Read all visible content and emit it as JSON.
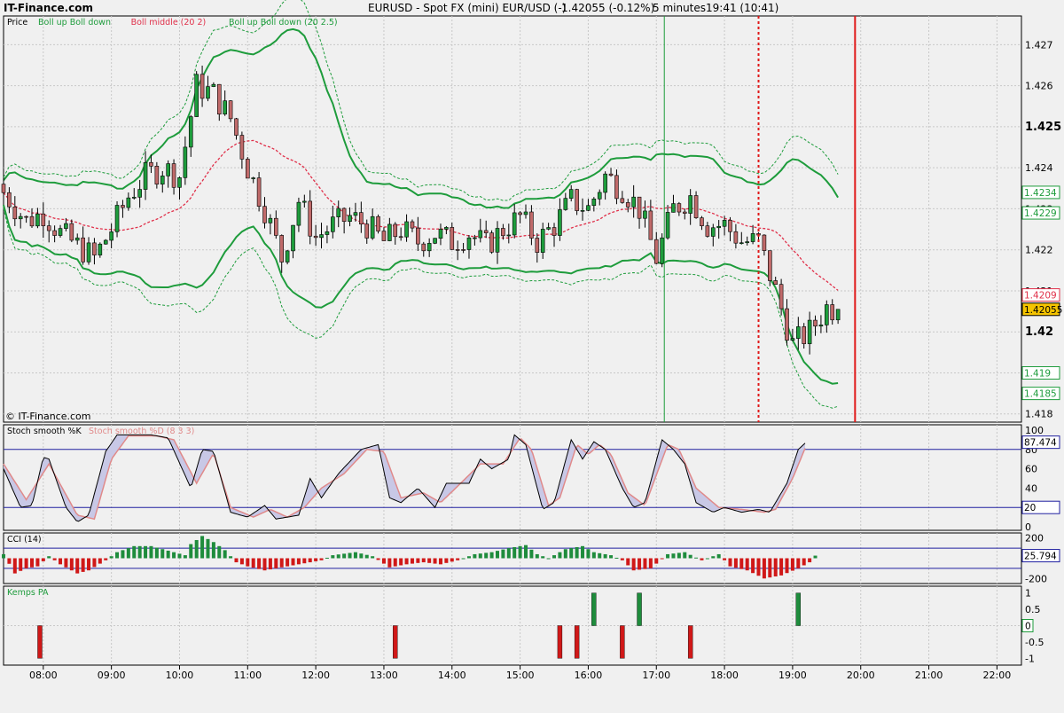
{
  "header": {
    "site": "IT-Finance.com",
    "title": "EURUSD - Spot FX (mini) EUR/USD (-)",
    "price": "1.42055 (-0.12%)",
    "interval": "5 minutes",
    "time": "19:41 (10:41)"
  },
  "watermark": "© IT-Finance.com",
  "colors": {
    "background": "#f0f0f0",
    "grid": "#c8c8c8",
    "candle_up": "#1e9c3c",
    "candle_down": "#c06a6a",
    "bollinger": "#1e9c3c",
    "boll_middle": "#e0304a",
    "stoch_k": "#000000",
    "stoch_d": "#e08a8a",
    "cci_up": "#1e8c3c",
    "cci_down": "#d01818",
    "now_line": "#e01818"
  },
  "chart_data": [
    {
      "type": "candlestick",
      "panel": "price",
      "legend": [
        "Price",
        "Boll up Boll down",
        "Boll middle (20 2)",
        "Boll up Boll down (20 2.5)"
      ],
      "x_ticks": [
        "08:00",
        "09:00",
        "10:00",
        "11:00",
        "12:00",
        "13:00",
        "14:00",
        "15:00",
        "16:00",
        "17:00",
        "18:00",
        "19:00",
        "20:00",
        "21:00",
        "22:00"
      ],
      "y_ticks": [
        "1.427",
        "1.426",
        "1.425",
        "1.424",
        "1.423",
        "1.422",
        "1.421",
        "1.42",
        "1.419",
        "1.418"
      ],
      "ylim": [
        1.4178,
        1.4277
      ],
      "x_range": [
        "07:25",
        "22:20"
      ],
      "markers": [
        {
          "label": "1.4234",
          "value": 1.4234,
          "color": "#1e9c3c"
        },
        {
          "label": "1.4229",
          "value": 1.4229,
          "color": "#1e9c3c"
        },
        {
          "label": "1.4209",
          "value": 1.4209,
          "color": "#e0304a"
        },
        {
          "label": "1.42055",
          "value": 1.42055,
          "color": "#000000",
          "bg": "#f5c400"
        },
        {
          "label": "1.419",
          "value": 1.419,
          "color": "#1e9c3c"
        },
        {
          "label": "1.4185",
          "value": 1.4185,
          "color": "#1e9c3c"
        }
      ],
      "vlines": [
        {
          "time": "17:07",
          "style": "solid",
          "color": "#1e9c3c"
        },
        {
          "time": "18:30",
          "style": "dotted",
          "color": "#e01818"
        },
        {
          "time": "19:55",
          "style": "solid",
          "color": "#e01818"
        }
      ],
      "ohlc_keyframes": [
        [
          "07:25",
          1.4234
        ],
        [
          "07:45",
          1.4227
        ],
        [
          "08:00",
          1.4229
        ],
        [
          "08:15",
          1.4224
        ],
        [
          "08:30",
          1.4221
        ],
        [
          "08:45",
          1.4218
        ],
        [
          "09:00",
          1.4225
        ],
        [
          "09:15",
          1.4233
        ],
        [
          "09:30",
          1.4238
        ],
        [
          "09:45",
          1.424
        ],
        [
          "10:00",
          1.4238
        ],
        [
          "10:15",
          1.426
        ],
        [
          "10:30",
          1.4258
        ],
        [
          "10:45",
          1.4252
        ],
        [
          "11:00",
          1.424
        ],
        [
          "11:15",
          1.423
        ],
        [
          "11:30",
          1.4218
        ],
        [
          "11:45",
          1.4232
        ],
        [
          "12:00",
          1.4223
        ],
        [
          "12:15",
          1.4226
        ],
        [
          "12:30",
          1.4228
        ],
        [
          "12:45",
          1.4226
        ],
        [
          "13:00",
          1.4222
        ],
        [
          "13:15",
          1.4225
        ],
        [
          "13:30",
          1.4222
        ],
        [
          "13:45",
          1.4224
        ],
        [
          "14:00",
          1.4222
        ],
        [
          "14:15",
          1.4224
        ],
        [
          "14:30",
          1.4221
        ],
        [
          "14:45",
          1.4225
        ],
        [
          "15:00",
          1.4228
        ],
        [
          "15:15",
          1.4222
        ],
        [
          "15:30",
          1.4226
        ],
        [
          "15:45",
          1.4232
        ],
        [
          "16:00",
          1.423
        ],
        [
          "16:15",
          1.4238
        ],
        [
          "16:30",
          1.4235
        ],
        [
          "16:45",
          1.423
        ],
        [
          "17:00",
          1.4218
        ],
        [
          "17:15",
          1.423
        ],
        [
          "17:30",
          1.4233
        ],
        [
          "17:45",
          1.4226
        ],
        [
          "18:00",
          1.4226
        ],
        [
          "18:15",
          1.4222
        ],
        [
          "18:30",
          1.4222
        ],
        [
          "18:45",
          1.421
        ],
        [
          "19:00",
          1.4197
        ],
        [
          "19:15",
          1.42
        ],
        [
          "19:30",
          1.4206
        ],
        [
          "19:41",
          1.42055
        ]
      ]
    },
    {
      "type": "line",
      "panel": "stochastic",
      "legend": [
        "Stoch smooth %K",
        "Stoch smooth %D (8 3 3)"
      ],
      "y_ticks": [
        "100",
        "80",
        "60",
        "40",
        "20",
        "0"
      ],
      "ylim": [
        0,
        100
      ],
      "levels": [
        20,
        80
      ],
      "markers": [
        {
          "label": "87.474",
          "value": 87.474
        },
        {
          "label": "20",
          "value": 20
        }
      ],
      "k_keyframes": [
        [
          "07:25",
          60
        ],
        [
          "07:40",
          20
        ],
        [
          "07:50",
          22
        ],
        [
          "08:00",
          72
        ],
        [
          "08:05",
          70
        ],
        [
          "08:20",
          20
        ],
        [
          "08:30",
          5
        ],
        [
          "08:40",
          12
        ],
        [
          "08:55",
          78
        ],
        [
          "09:05",
          95
        ],
        [
          "09:35",
          95
        ],
        [
          "09:50",
          92
        ],
        [
          "10:10",
          40
        ],
        [
          "10:20",
          80
        ],
        [
          "10:30",
          78
        ],
        [
          "10:45",
          15
        ],
        [
          "11:00",
          10
        ],
        [
          "11:15",
          22
        ],
        [
          "11:25",
          8
        ],
        [
          "11:45",
          12
        ],
        [
          "11:55",
          50
        ],
        [
          "12:05",
          30
        ],
        [
          "12:20",
          55
        ],
        [
          "12:40",
          80
        ],
        [
          "12:55",
          85
        ],
        [
          "13:05",
          30
        ],
        [
          "13:15",
          25
        ],
        [
          "13:30",
          40
        ],
        [
          "13:45",
          20
        ],
        [
          "13:55",
          45
        ],
        [
          "14:15",
          45
        ],
        [
          "14:25",
          70
        ],
        [
          "14:35",
          60
        ],
        [
          "14:50",
          70
        ],
        [
          "14:55",
          95
        ],
        [
          "15:05",
          85
        ],
        [
          "15:20",
          18
        ],
        [
          "15:30",
          25
        ],
        [
          "15:45",
          90
        ],
        [
          "15:55",
          70
        ],
        [
          "16:05",
          88
        ],
        [
          "16:15",
          80
        ],
        [
          "16:30",
          40
        ],
        [
          "16:40",
          20
        ],
        [
          "16:50",
          25
        ],
        [
          "17:05",
          90
        ],
        [
          "17:15",
          80
        ],
        [
          "17:25",
          65
        ],
        [
          "17:35",
          25
        ],
        [
          "17:50",
          15
        ],
        [
          "18:00",
          20
        ],
        [
          "18:15",
          15
        ],
        [
          "18:30",
          18
        ],
        [
          "18:40",
          15
        ],
        [
          "18:55",
          45
        ],
        [
          "19:05",
          80
        ],
        [
          "19:12",
          87.474
        ]
      ],
      "d_keyframes": [
        [
          "07:25",
          65
        ],
        [
          "07:45",
          28
        ],
        [
          "08:05",
          65
        ],
        [
          "08:30",
          12
        ],
        [
          "08:45",
          8
        ],
        [
          "09:00",
          70
        ],
        [
          "09:15",
          94
        ],
        [
          "09:40",
          94
        ],
        [
          "09:55",
          90
        ],
        [
          "10:15",
          45
        ],
        [
          "10:30",
          76
        ],
        [
          "10:45",
          20
        ],
        [
          "11:05",
          10
        ],
        [
          "11:20",
          18
        ],
        [
          "11:35",
          10
        ],
        [
          "11:50",
          20
        ],
        [
          "12:05",
          40
        ],
        [
          "12:25",
          55
        ],
        [
          "12:45",
          80
        ],
        [
          "13:00",
          78
        ],
        [
          "13:15",
          30
        ],
        [
          "13:35",
          35
        ],
        [
          "13:50",
          25
        ],
        [
          "14:05",
          42
        ],
        [
          "14:25",
          65
        ],
        [
          "14:45",
          65
        ],
        [
          "15:00",
          92
        ],
        [
          "15:10",
          80
        ],
        [
          "15:25",
          22
        ],
        [
          "15:35",
          30
        ],
        [
          "15:50",
          85
        ],
        [
          "16:00",
          75
        ],
        [
          "16:10",
          85
        ],
        [
          "16:20",
          75
        ],
        [
          "16:35",
          35
        ],
        [
          "16:50",
          22
        ],
        [
          "17:10",
          85
        ],
        [
          "17:20",
          80
        ],
        [
          "17:35",
          40
        ],
        [
          "17:55",
          20
        ],
        [
          "18:15",
          18
        ],
        [
          "18:35",
          15
        ],
        [
          "18:45",
          18
        ],
        [
          "19:00",
          50
        ],
        [
          "19:12",
          84
        ]
      ]
    },
    {
      "type": "bar",
      "panel": "cci",
      "legend": [
        "CCI (14)"
      ],
      "y_ticks": [
        "200",
        "0",
        "-200"
      ],
      "ylim": [
        -250,
        250
      ],
      "markers": [
        {
          "label": "25.794",
          "value": 25.794
        }
      ],
      "keyframes": [
        [
          "07:25",
          40
        ],
        [
          "07:35",
          -150
        ],
        [
          "07:45",
          -100
        ],
        [
          "07:55",
          -80
        ],
        [
          "08:05",
          20
        ],
        [
          "08:15",
          -60
        ],
        [
          "08:30",
          -150
        ],
        [
          "08:40",
          -120
        ],
        [
          "08:55",
          -20
        ],
        [
          "09:05",
          60
        ],
        [
          "09:20",
          120
        ],
        [
          "09:35",
          120
        ],
        [
          "09:45",
          90
        ],
        [
          "10:05",
          30
        ],
        [
          "10:10",
          140
        ],
        [
          "10:20",
          220
        ],
        [
          "10:30",
          160
        ],
        [
          "10:40",
          80
        ],
        [
          "10:50",
          -40
        ],
        [
          "11:00",
          -80
        ],
        [
          "11:15",
          -120
        ],
        [
          "11:30",
          -90
        ],
        [
          "11:50",
          -50
        ],
        [
          "12:05",
          -20
        ],
        [
          "12:15",
          30
        ],
        [
          "12:35",
          60
        ],
        [
          "12:50",
          20
        ],
        [
          "13:05",
          -90
        ],
        [
          "13:20",
          -60
        ],
        [
          "13:35",
          -40
        ],
        [
          "13:50",
          -60
        ],
        [
          "14:05",
          -20
        ],
        [
          "14:20",
          40
        ],
        [
          "14:35",
          60
        ],
        [
          "14:50",
          100
        ],
        [
          "15:05",
          130
        ],
        [
          "15:15",
          40
        ],
        [
          "15:25",
          0
        ],
        [
          "15:40",
          90
        ],
        [
          "15:55",
          120
        ],
        [
          "16:05",
          60
        ],
        [
          "16:20",
          30
        ],
        [
          "16:30",
          -20
        ],
        [
          "16:40",
          -120
        ],
        [
          "16:55",
          -100
        ],
        [
          "17:10",
          40
        ],
        [
          "17:25",
          60
        ],
        [
          "17:40",
          -20
        ],
        [
          "17:55",
          40
        ],
        [
          "18:05",
          -80
        ],
        [
          "18:20",
          -120
        ],
        [
          "18:35",
          -200
        ],
        [
          "18:50",
          -170
        ],
        [
          "19:05",
          -100
        ],
        [
          "19:15",
          -40
        ],
        [
          "19:20",
          25.794
        ]
      ]
    },
    {
      "type": "bar",
      "panel": "kemps",
      "legend": [
        "Kemps PA"
      ],
      "y_ticks": [
        "1",
        "0.5",
        "0",
        "-0.5",
        "-1"
      ],
      "ylim": [
        -1.1,
        1.1
      ],
      "markers": [
        {
          "label": "0",
          "value": 0
        }
      ],
      "bars": [
        {
          "time": "07:57",
          "value": -1
        },
        {
          "time": "13:10",
          "value": -1
        },
        {
          "time": "15:35",
          "value": -1
        },
        {
          "time": "15:50",
          "value": -1
        },
        {
          "time": "16:05",
          "value": 1
        },
        {
          "time": "16:30",
          "value": -1
        },
        {
          "time": "16:45",
          "value": 1
        },
        {
          "time": "17:30",
          "value": -1
        },
        {
          "time": "19:05",
          "value": 1
        }
      ]
    }
  ]
}
